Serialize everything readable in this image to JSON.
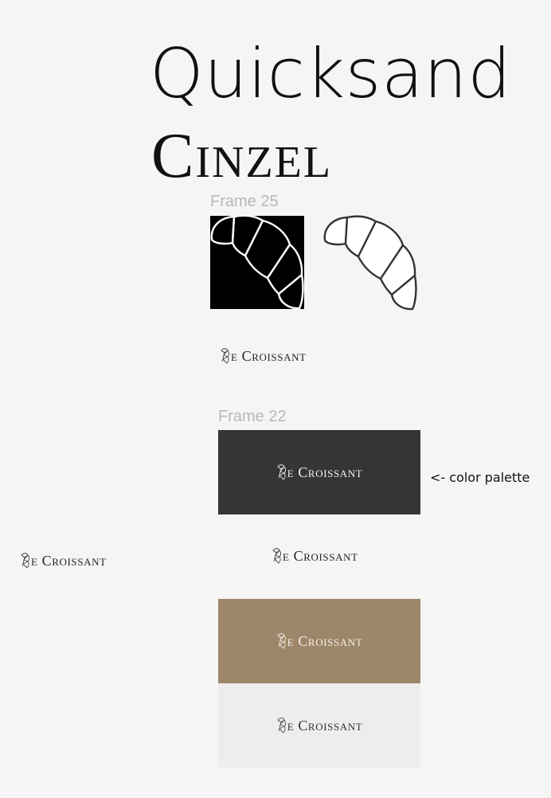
{
  "fonts": {
    "primary": "Quicksand",
    "secondary": "Cinzel"
  },
  "frames": {
    "frame_25": "Frame 25",
    "frame_22": "Frame 22"
  },
  "brand": {
    "wordmark": "e Croissant",
    "icon": "croissant-icon"
  },
  "annotation": "<- color palette",
  "palette": {
    "dark": "#353535",
    "brown": "#9e866b",
    "cream": "#eeedeb",
    "white": "#ffffff",
    "black": "#000000"
  }
}
